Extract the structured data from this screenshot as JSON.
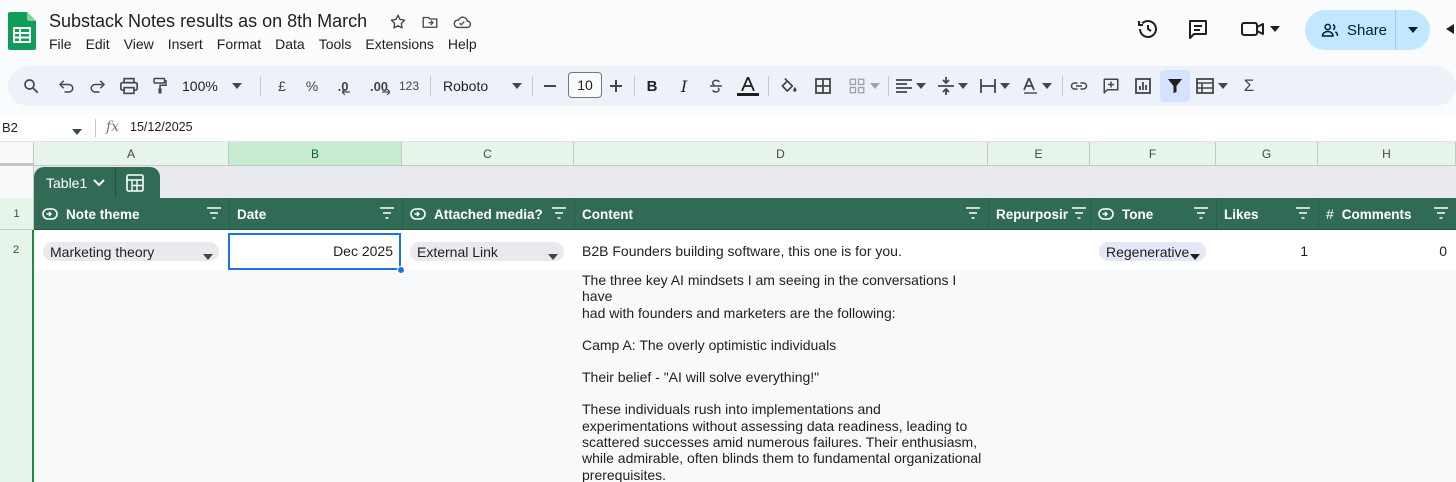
{
  "document": {
    "title": "Substack Notes results as on 8th March",
    "menu": [
      "File",
      "Edit",
      "View",
      "Insert",
      "Format",
      "Data",
      "Tools",
      "Extensions",
      "Help"
    ],
    "share_label": "Share"
  },
  "toolbar": {
    "zoom": "100%",
    "currency": "£",
    "percent": "%",
    "decrease_decimal": ".0",
    "increase_decimal": ".00",
    "number_format": "123",
    "font": "Roboto",
    "font_size": "10"
  },
  "formula_bar": {
    "cell_ref": "B2",
    "fx": "fx",
    "value": "15/12/2025"
  },
  "columns": [
    "A",
    "B",
    "C",
    "D",
    "E",
    "F",
    "G",
    "H"
  ],
  "rows": [
    "1",
    "2"
  ],
  "table": {
    "name": "Table1",
    "headers": [
      "Note theme",
      "Date",
      "Attached media?",
      "Content",
      "Repurposir",
      "Tone",
      "Likes",
      "#",
      "Comments"
    ]
  },
  "row2": {
    "note_theme": "Marketing theory",
    "date": "Dec 2025",
    "attached_media": "External Link",
    "tone": "Regenerative",
    "likes": "1",
    "comments": "0",
    "content": [
      "B2B Founders building software, this one is for you.",
      "The three key AI mindsets I am seeing in the conversations I have",
      "had with founders and marketers are the following:",
      "Camp A: The overly optimistic individuals",
      "Their belief - \"AI will solve everything!\"",
      "These individuals rush into implementations and",
      "experimentations without assessing data readiness, leading to",
      "scattered successes amid numerous failures. Their enthusiasm,",
      "while admirable, often blinds them to fundamental organizational",
      "prerequisites."
    ]
  },
  "colors": {
    "table_header": "#326b55",
    "selection": "#1a73e8",
    "share_button": "#c2e7ff"
  }
}
